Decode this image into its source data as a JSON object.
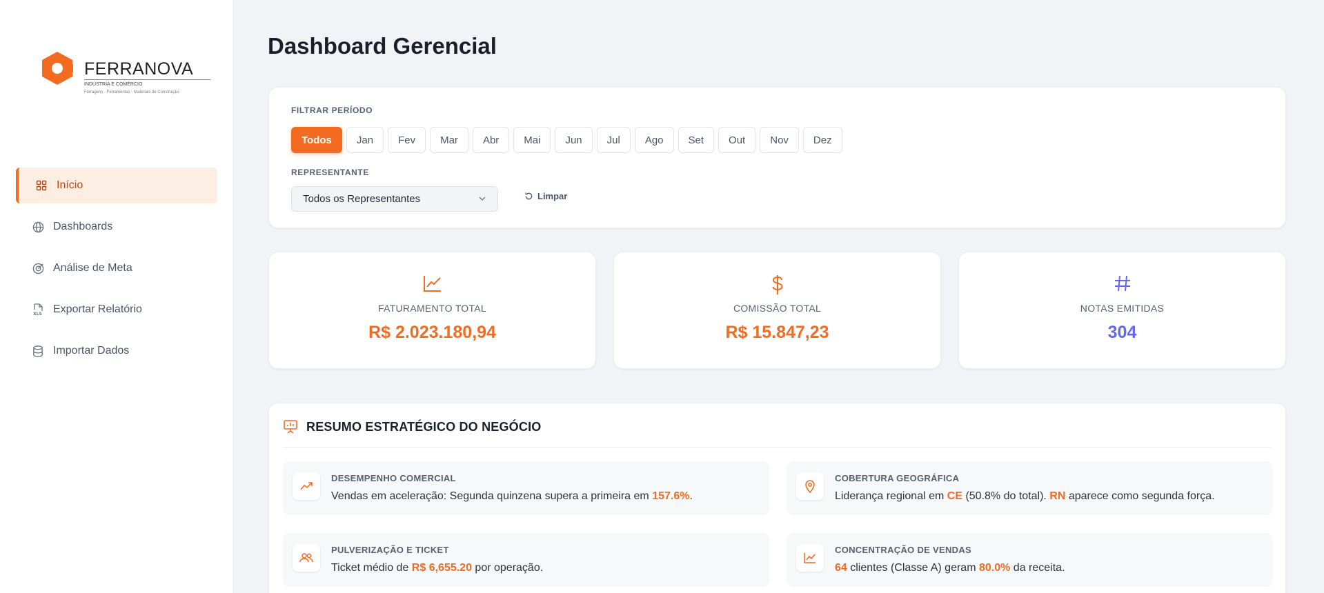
{
  "brand": {
    "name": "FERRANOVA",
    "subtitle": "INDÚSTRIA E COMÉRCIO",
    "tagline": "Ferragens · Ferramentas · Materiais de Construção",
    "accent": "#f26b21"
  },
  "sidebar": {
    "items": [
      {
        "label": "Início",
        "icon": "grid-icon",
        "active": true
      },
      {
        "label": "Dashboards",
        "icon": "globe-icon"
      },
      {
        "label": "Análise de Meta",
        "icon": "target-icon"
      },
      {
        "label": "Exportar Relatório",
        "icon": "xls-file-icon"
      },
      {
        "label": "Importar Dados",
        "icon": "database-icon"
      }
    ]
  },
  "page": {
    "title": "Dashboard Gerencial"
  },
  "filters": {
    "period_label": "FILTRAR PERÍODO",
    "months": [
      "Todos",
      "Jan",
      "Fev",
      "Mar",
      "Abr",
      "Mai",
      "Jun",
      "Jul",
      "Ago",
      "Set",
      "Out",
      "Nov",
      "Dez"
    ],
    "selected_month": "Todos",
    "rep_label": "REPRESENTANTE",
    "rep_value": "Todos os Representantes",
    "clear_label": "Limpar"
  },
  "stats": [
    {
      "label": "FATURAMENTO TOTAL",
      "value": "R$ 2.023.180,94",
      "icon": "trending-up-chart-icon",
      "color": "#f26b21"
    },
    {
      "label": "COMISSÃO TOTAL",
      "value": "R$ 15.847,23",
      "icon": "dollar-icon",
      "color": "#f26b21"
    },
    {
      "label": "NOTAS EMITIDAS",
      "value": "304",
      "icon": "hash-icon",
      "color": "#6366f1"
    }
  ],
  "summary": {
    "title": "RESUMO ESTRATÉGICO DO NEGÓCIO",
    "insights": [
      {
        "title": "DESEMPENHO COMERCIAL",
        "icon": "trending-up-icon",
        "text_parts": [
          "Vendas em aceleração: Segunda quinzena supera a primeira em ",
          "157.6%",
          "."
        ]
      },
      {
        "title": "COBERTURA GEOGRÁFICA",
        "icon": "map-pin-icon",
        "text_parts": [
          "Liderança regional em ",
          "CE",
          " (50.8% do total). ",
          "RN",
          " aparece como segunda força."
        ]
      },
      {
        "title": "PULVERIZAÇÃO E TICKET",
        "icon": "users-icon",
        "text_parts": [
          "Ticket médio de ",
          "R$ 6,655.20",
          " por operação."
        ]
      },
      {
        "title": "CONCENTRAÇÃO DE VENDAS",
        "icon": "line-chart-icon",
        "text_parts": [
          "",
          "64",
          " clientes (Classe A) geram ",
          "80.0%",
          " da receita."
        ]
      }
    ]
  }
}
